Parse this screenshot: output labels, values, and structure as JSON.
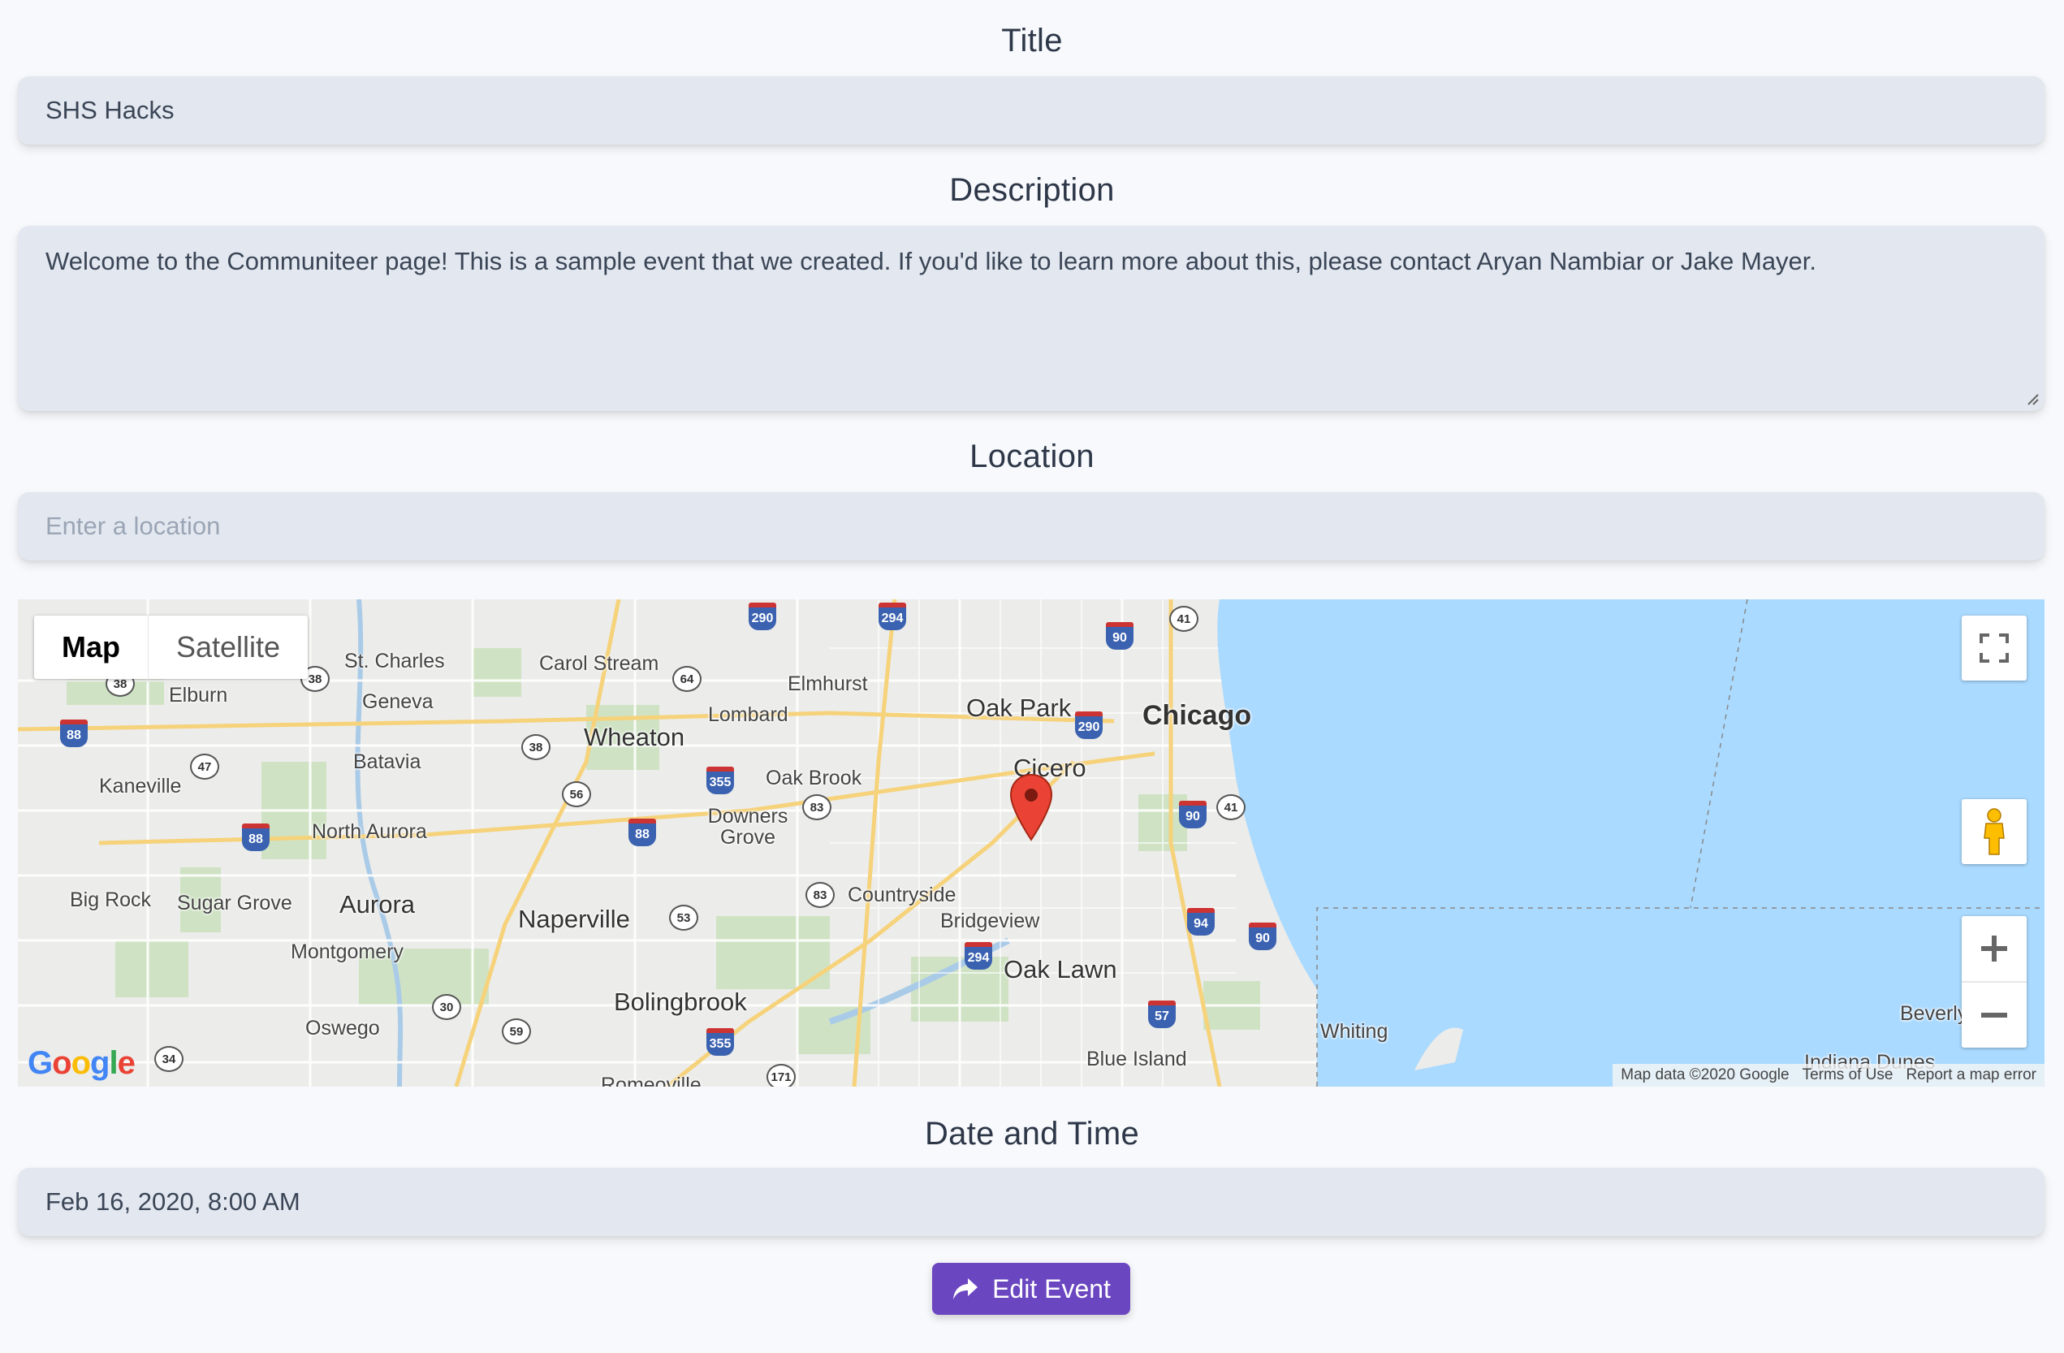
{
  "title": {
    "label": "Title",
    "value": "SHS Hacks"
  },
  "description": {
    "label": "Description",
    "value": "Welcome to the Communiteer page! This is a sample event that we created. If you'd like to learn more about this, please contact Aryan Nambiar or Jake Mayer."
  },
  "location": {
    "label": "Location",
    "placeholder": "Enter a location"
  },
  "map": {
    "type_map": "Map",
    "type_satellite": "Satellite",
    "attribution": {
      "data": "Map data ©2020 Google",
      "terms": "Terms of Use",
      "report": "Report a map error"
    },
    "logo": "Google",
    "places": {
      "chicago": "Chicago",
      "oak_park": "Oak Park",
      "cicero": "Cicero",
      "elmhurst": "Elmhurst",
      "carol_stream": "Carol Stream",
      "st_charles": "St. Charles",
      "geneva": "Geneva",
      "elburn": "Elburn",
      "lombard": "Lombard",
      "wheaton": "Wheaton",
      "batavia": "Batavia",
      "kaneville": "Kaneville",
      "oak_brook": "Oak Brook",
      "downers_grove": "Downers Grove",
      "north_aurora": "North Aurora",
      "aurora": "Aurora",
      "big_rock": "Big Rock",
      "sugar_grove": "Sugar Grove",
      "naperville": "Naperville",
      "countryside": "Countryside",
      "bridgeview": "Bridgeview",
      "montgomery": "Montgomery",
      "oak_lawn": "Oak Lawn",
      "bolingbrook": "Bolingbrook",
      "oswego": "Oswego",
      "whiting": "Whiting",
      "blue_island": "Blue Island",
      "romeoville": "Romeoville",
      "beverly": "Beverly",
      "indiana_dunes": "Indiana Dunes"
    },
    "highways": {
      "i290a": "290",
      "i294a": "294",
      "us41a": "41",
      "i90a": "90",
      "i290b": "290",
      "us38a": "38",
      "us38b": "38",
      "us64": "64",
      "i88a": "88",
      "us38c": "38",
      "us47": "47",
      "i355a": "355",
      "us56": "56",
      "us83a": "83",
      "i88b": "88",
      "i88c": "88",
      "i90b": "90",
      "us41b": "41",
      "us83b": "83",
      "us53": "53",
      "i94": "94",
      "i90c": "90",
      "i294b": "294",
      "i57": "57",
      "us30": "30",
      "us59": "59",
      "i355b": "355",
      "us34": "34",
      "us171": "171"
    }
  },
  "datetime": {
    "label": "Date and Time",
    "value": "Feb 16, 2020, 8:00 AM"
  },
  "edit_button": {
    "label": "Edit Event"
  }
}
